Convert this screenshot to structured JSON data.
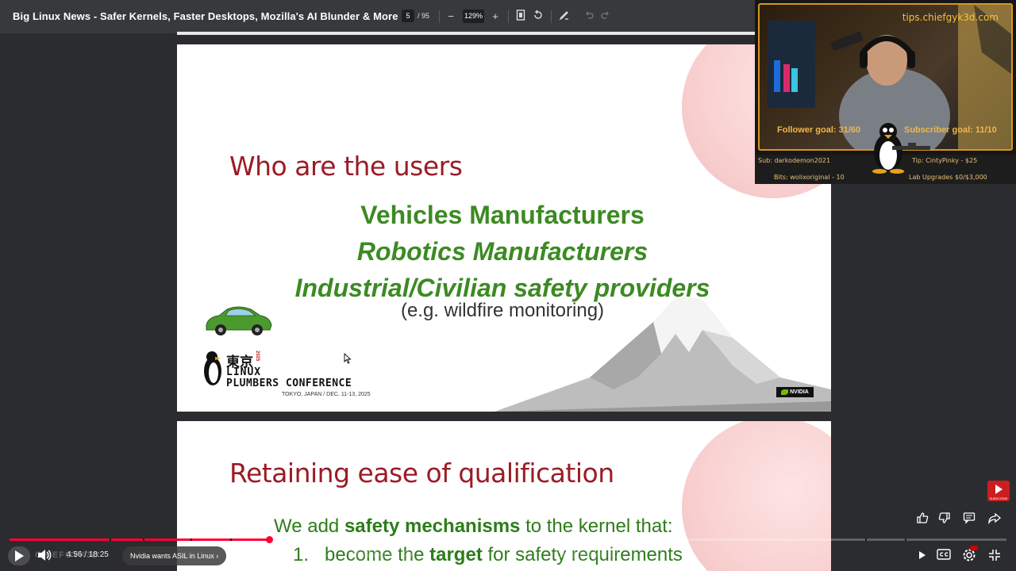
{
  "video": {
    "title": "Big Linux News - Safer Kernels, Faster Desktops, Mozilla's AI Blunder & More",
    "time_current": "4:56",
    "time_separator": "/",
    "time_total": "18:25",
    "progress": 0.26,
    "chapter_label": "Nvidia wants ASIL in Linux",
    "chapter_chevron": "›",
    "watermark": "CHIEFGYK3D",
    "subscribe_label": "SUBSCRIBE"
  },
  "pdf_toolbar": {
    "page_current": "5",
    "page_total": "/ 95",
    "zoom": "129%",
    "zoom_out": "−",
    "zoom_in": "+"
  },
  "slide1": {
    "title": "Who are the users",
    "line1": "Vehicles Manufacturers",
    "line2": "Robotics Manufacturers",
    "line3": "Industrial/Civilian safety providers",
    "line4": "(e.g. wildfire monitoring)",
    "conf_kanji": "東京",
    "conf_year": "2025",
    "conf_linux": "LINUX",
    "conf_plumbers": "PLUMBERS CONFERENCE",
    "conf_date": "TOKYO, JAPAN / DEC. 11-13, 2025",
    "nvidia": "NVIDIA"
  },
  "slide2": {
    "title": "Retaining ease of qualification",
    "intro_pre": "We add ",
    "intro_bold": "safety mechanisms",
    "intro_post": " to the kernel that:",
    "item1_num": "1.",
    "item1_pre": "become the ",
    "item1_bold": "target",
    "item1_post": " for safety requirements"
  },
  "overlay": {
    "tips": "tips.chiefgyk3d.com",
    "follower_goal": "Follower goal: 31/60",
    "subscriber_goal": "Subscriber goal: 11/10",
    "last_sub": "Sub: darkodemon2021",
    "last_tip": "Tip: CintyPinky - $25",
    "last_bits": "Bits: wolixoriginal - 10",
    "lab_upgrades": "Lab Upgrades $0/$3,000"
  },
  "colors": {
    "slide_title": "#9b1b25",
    "green": "#3c8a23",
    "progress": "#ff0033",
    "overlay_gold": "#f0b64a"
  }
}
